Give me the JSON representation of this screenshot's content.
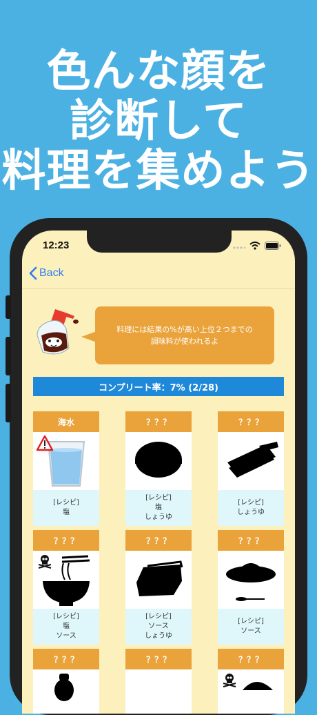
{
  "promo": {
    "lines": [
      "色んな顔を",
      "診断して",
      "料理を集めよう"
    ]
  },
  "status": {
    "time": "12:23"
  },
  "nav": {
    "back_label": "Back"
  },
  "hint": {
    "line1": "料理には結果の%が高い上位２つまでの",
    "line2": "調味料が使われるよ"
  },
  "completion": {
    "text": "コンプリート率：7% (2/28)",
    "percent": 7,
    "collected": 2,
    "total": 28
  },
  "cards": [
    {
      "name": "海水",
      "recipe_label": "[レシピ]",
      "line1": "塩",
      "line2": "",
      "image": "water-glass-warning"
    },
    {
      "name": "？？？",
      "recipe_label": "[レシピ]",
      "line1": "塩",
      "line2": "しょうゆ",
      "image": "rice-bowl-silhouette"
    },
    {
      "name": "？？？",
      "recipe_label": "[レシピ]",
      "line1": "しょうゆ",
      "line2": "",
      "image": "sushi-roll-silhouette"
    },
    {
      "name": "？？？",
      "recipe_label": "[レシピ]",
      "line1": "塩",
      "line2": "ソース",
      "image": "noodle-bowl-skull"
    },
    {
      "name": "？？？",
      "recipe_label": "[レシピ]",
      "line1": "ソース",
      "line2": "しょうゆ",
      "image": "toast-silhouette"
    },
    {
      "name": "？？？",
      "recipe_label": "[レシピ]",
      "line1": "ソース",
      "line2": "",
      "image": "curry-plate-silhouette"
    },
    {
      "name": "？？？",
      "recipe_label": "",
      "line1": "",
      "line2": "",
      "image": "bottle-silhouette"
    },
    {
      "name": "？？？",
      "recipe_label": "",
      "line1": "",
      "line2": "",
      "image": "unknown"
    },
    {
      "name": "？？？",
      "recipe_label": "",
      "line1": "",
      "line2": "",
      "image": "dish-skull"
    }
  ]
}
